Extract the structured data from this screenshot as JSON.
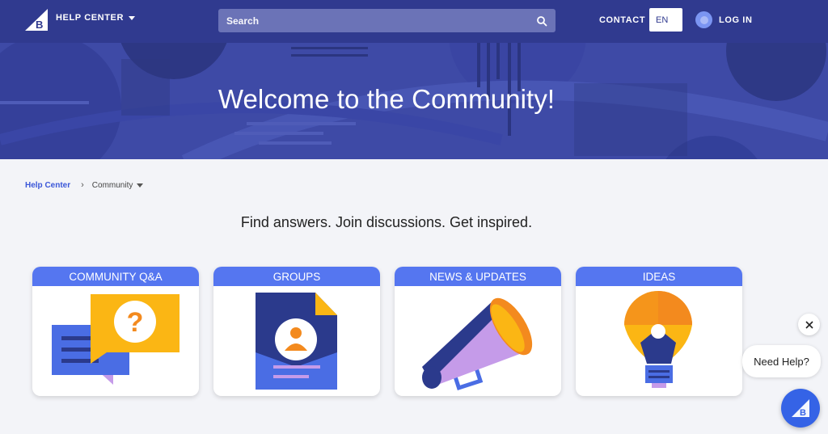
{
  "nav": {
    "help_center": "HELP CENTER",
    "search_placeholder": "Search",
    "contact": "CONTACT",
    "language": "EN",
    "login": "LOG IN"
  },
  "hero": {
    "title": "Welcome to the Community!"
  },
  "breadcrumb": {
    "home": "Help Center",
    "separator": "›",
    "current": "Community"
  },
  "tagline": "Find answers. Join discussions. Get inspired.",
  "cards": [
    {
      "title": "COMMUNITY Q&A",
      "icon": "chat-question-icon"
    },
    {
      "title": "GROUPS",
      "icon": "group-document-icon"
    },
    {
      "title": "NEWS & UPDATES",
      "icon": "megaphone-icon"
    },
    {
      "title": "IDEAS",
      "icon": "lightbulb-icon"
    }
  ],
  "chat": {
    "prompt": "Need Help?",
    "close_icon": "close-icon",
    "launcher_icon": "bigcommerce-logo-icon"
  },
  "colors": {
    "nav_bg": "#303a8f",
    "hero_bg": "#3e4aa6",
    "card_header": "#5576f0",
    "accent": "#3563e6",
    "yellow": "#fbb614",
    "orange": "#f38a1e"
  }
}
